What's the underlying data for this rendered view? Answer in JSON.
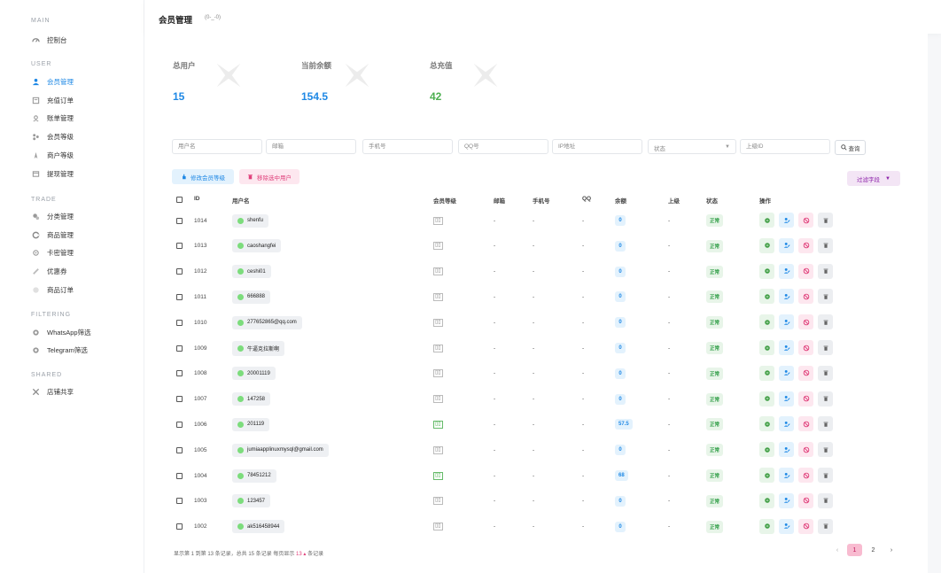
{
  "sidebar": {
    "sections": [
      {
        "title": "MAIN",
        "items": [
          {
            "label": "控制台",
            "icon": "dashboard-icon"
          }
        ]
      },
      {
        "title": "USER",
        "items": [
          {
            "label": "会员管理",
            "icon": "user-icon",
            "active": true
          },
          {
            "label": "充值订单",
            "icon": "order-icon"
          },
          {
            "label": "账单管理",
            "icon": "bill-icon"
          },
          {
            "label": "会员等级",
            "icon": "level-icon"
          },
          {
            "label": "商户等级",
            "icon": "merchant-icon"
          },
          {
            "label": "提现管理",
            "icon": "withdraw-icon"
          }
        ]
      },
      {
        "title": "TRADE",
        "items": [
          {
            "label": "分类管理",
            "icon": "category-icon"
          },
          {
            "label": "商品管理",
            "icon": "goods-icon"
          },
          {
            "label": "卡密管理",
            "icon": "card-icon"
          },
          {
            "label": "优惠券",
            "icon": "coupon-icon"
          },
          {
            "label": "商品订单",
            "icon": "goods-order-icon"
          }
        ]
      },
      {
        "title": "FILTERING",
        "items": [
          {
            "label": "WhatsApp筛选",
            "icon": "whatsapp-icon"
          },
          {
            "label": "Telegram筛选",
            "icon": "telegram-icon"
          }
        ]
      },
      {
        "title": "SHARED",
        "items": [
          {
            "label": "店铺共享",
            "icon": "share-icon"
          }
        ]
      }
    ]
  },
  "header": {
    "title": "会员管理",
    "subtitle": "(0-_-0)"
  },
  "stats": [
    {
      "label": "总用户",
      "value": "15",
      "color": "#1e88e5"
    },
    {
      "label": "当前余额",
      "value": "154.5",
      "color": "#1e88e5"
    },
    {
      "label": "总充值",
      "value": "42",
      "color": "#4caf50"
    }
  ],
  "filters": {
    "username": "用户名",
    "email": "邮箱",
    "phone": "手机号",
    "qq": "QQ号",
    "ip": "IP地址",
    "status": "状态",
    "parent_id": "上级ID",
    "query_button": "查询"
  },
  "actions": {
    "change_level": "修改会员等级",
    "delete_selected": "移除选中用户",
    "filter_fields": "过滤字段"
  },
  "table": {
    "headers": {
      "id": "ID",
      "username": "用户名",
      "level": "会员等级",
      "email": "邮箱",
      "phone": "手机号",
      "qq": "QQ",
      "balance": "余额",
      "parent": "上级",
      "status": "状态",
      "ops": "操作"
    },
    "rows": [
      {
        "id": "1014",
        "username": "shenfu",
        "level_hl": false,
        "email": "-",
        "phone": "-",
        "qq": "-",
        "balance": "0",
        "parent": "-",
        "status": "正常"
      },
      {
        "id": "1013",
        "username": "caoshangfei",
        "level_hl": false,
        "email": "-",
        "phone": "-",
        "qq": "-",
        "balance": "0",
        "parent": "-",
        "status": "正常"
      },
      {
        "id": "1012",
        "username": "ceshi01",
        "level_hl": false,
        "email": "-",
        "phone": "-",
        "qq": "-",
        "balance": "0",
        "parent": "-",
        "status": "正常"
      },
      {
        "id": "1011",
        "username": "666888",
        "level_hl": false,
        "email": "-",
        "phone": "-",
        "qq": "-",
        "balance": "0",
        "parent": "-",
        "status": "正常"
      },
      {
        "id": "1010",
        "username": "277652865@qq.com",
        "level_hl": false,
        "email": "-",
        "phone": "-",
        "qq": "-",
        "balance": "0",
        "parent": "-",
        "status": "正常"
      },
      {
        "id": "1009",
        "username": "牛逼克拉斯啊",
        "level_hl": false,
        "email": "-",
        "phone": "-",
        "qq": "-",
        "balance": "0",
        "parent": "-",
        "status": "正常"
      },
      {
        "id": "1008",
        "username": "20001119",
        "level_hl": false,
        "email": "-",
        "phone": "-",
        "qq": "-",
        "balance": "0",
        "parent": "-",
        "status": "正常"
      },
      {
        "id": "1007",
        "username": "147258",
        "level_hl": false,
        "email": "-",
        "phone": "-",
        "qq": "-",
        "balance": "0",
        "parent": "-",
        "status": "正常"
      },
      {
        "id": "1006",
        "username": "201119",
        "level_hl": true,
        "email": "-",
        "phone": "-",
        "qq": "-",
        "balance": "57.5",
        "parent": "-",
        "status": "正常"
      },
      {
        "id": "1005",
        "username": "jumiaapplinuxmysql@gmail.com",
        "level_hl": false,
        "email": "-",
        "phone": "-",
        "qq": "-",
        "balance": "0",
        "parent": "-",
        "status": "正常"
      },
      {
        "id": "1004",
        "username": "78451212",
        "level_hl": true,
        "email": "-",
        "phone": "-",
        "qq": "-",
        "balance": "68",
        "parent": "-",
        "status": "正常"
      },
      {
        "id": "1003",
        "username": "123457",
        "level_hl": false,
        "email": "-",
        "phone": "-",
        "qq": "-",
        "balance": "0",
        "parent": "-",
        "status": "正常"
      },
      {
        "id": "1002",
        "username": "ak516458944",
        "level_hl": false,
        "email": "-",
        "phone": "-",
        "qq": "-",
        "balance": "0",
        "parent": "-",
        "status": "正常"
      }
    ]
  },
  "footer": {
    "summary_pre": "显示第 1 到第 13 条记录，总共 15 条记录  每页显示",
    "per_page": "13",
    "summary_post": "条记录"
  },
  "pagination": {
    "prev": "‹",
    "pages": [
      "1",
      "2"
    ],
    "next": "›"
  }
}
